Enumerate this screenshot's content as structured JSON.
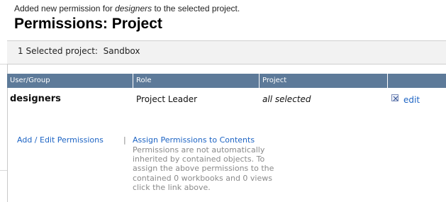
{
  "notice": {
    "prefix": "Added new permission for ",
    "group": "designers",
    "suffix": " to the selected project."
  },
  "page_title": "Permissions: Project",
  "selected": {
    "label": "1 Selected project:",
    "value": "Sandbox"
  },
  "table": {
    "headers": [
      "User/Group",
      "Role",
      "Project",
      ""
    ],
    "rows": [
      {
        "user_group": "designers",
        "role": "Project Leader",
        "project": "all selected",
        "action": "edit"
      }
    ]
  },
  "links": {
    "add_edit": "Add / Edit Permissions",
    "separator": "|",
    "assign": "Assign Permissions to Contents"
  },
  "help_text": "Permissions are not automatically inherited by contained objects. To assign the above permissions to the contained 0 workbooks and 0 views click the link above.",
  "colors": {
    "header_bg": "#5d7a99",
    "link": "#1d64c4",
    "help_text": "#8a8a8a"
  },
  "icons": {
    "delete": "delete-checkbox-icon"
  }
}
